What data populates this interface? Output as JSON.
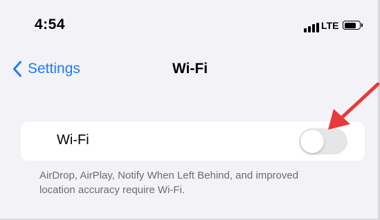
{
  "status_bar": {
    "time": "4:54",
    "carrier": "LTE",
    "battery_level": 0.85
  },
  "nav": {
    "back_label": "Settings",
    "title": "Wi-Fi"
  },
  "wifi_row": {
    "label": "Wi-Fi",
    "toggle_on": false
  },
  "footnote": "AirDrop, AirPlay, Notify When Left Behind, and improved location accuracy require Wi-Fi.",
  "colors": {
    "background": "#f2f2f7",
    "accent": "#1e7cf3",
    "annotation_arrow": "#e8383a",
    "toggle_off_track": "#e6e6e9"
  },
  "icons": {
    "back": "chevron-left-icon",
    "signal": "signal-bars-icon",
    "battery": "battery-icon",
    "annotation": "red-arrow-icon"
  }
}
